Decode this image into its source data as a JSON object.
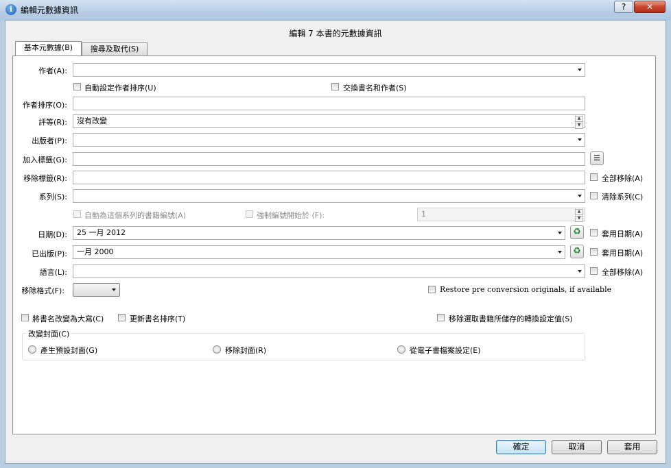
{
  "window": {
    "title": "編輯元數據資訊",
    "help": "?",
    "close": "✕"
  },
  "heading": "編輯 7 本書的元數據資訊",
  "tabs": [
    {
      "label": "基本元數據(B)"
    },
    {
      "label": "搜尋及取代(S)"
    }
  ],
  "fields": {
    "author": {
      "label": "作者(A):",
      "value": ""
    },
    "auto_author_sort": "自動設定作者排序(U)",
    "swap_title_author": "交換書名和作者(S)",
    "author_sort": {
      "label": "作者排序(O):",
      "value": ""
    },
    "rating": {
      "label": "評等(R):",
      "value": "沒有改變"
    },
    "publisher": {
      "label": "出版者(P):",
      "value": ""
    },
    "add_tags": {
      "label": "加入標籤(G):",
      "value": ""
    },
    "remove_tags": {
      "label": "移除標籤(R):",
      "value": "",
      "check": "全部移除(A)"
    },
    "series": {
      "label": "系列(S):",
      "value": "",
      "check": "清除系列(C)"
    },
    "auto_number": "自動為這個系列的書籍編號(A)",
    "force_number": "強制編號開始於 (F):",
    "force_number_value": "1",
    "date": {
      "label": "日期(D):",
      "value": "25 一月 2012",
      "check": "套用日期(A)"
    },
    "published": {
      "label": "已出版(P):",
      "value": "一月 2000",
      "check": "套用日期(A)"
    },
    "language": {
      "label": "語言(L):",
      "value": "",
      "check": "全部移除(A)"
    },
    "remove_format": {
      "label": "移除格式(F):"
    },
    "restore_originals": "Restore pre conversion originals, if available",
    "title_case": "將書名改變為大寫(C)",
    "update_title_sort": "更新書名排序(T)",
    "remove_conversion_settings": "移除選取書籍所儲存的轉換設定值(S)"
  },
  "cover": {
    "title": "改變封面(C)",
    "options": [
      "產生預設封面(G)",
      "移除封面(R)",
      "從電子書檔案設定(E)"
    ]
  },
  "buttons": {
    "ok": "確定",
    "cancel": "取消",
    "apply": "套用"
  },
  "icons": {
    "recycle": "recycle-icon",
    "tag_editor": "tag-editor-icon",
    "info": "info-icon"
  },
  "colors": {
    "titlebar": "#b9cfe6",
    "close": "#c7432b",
    "recycle": "#1d8a2a"
  }
}
